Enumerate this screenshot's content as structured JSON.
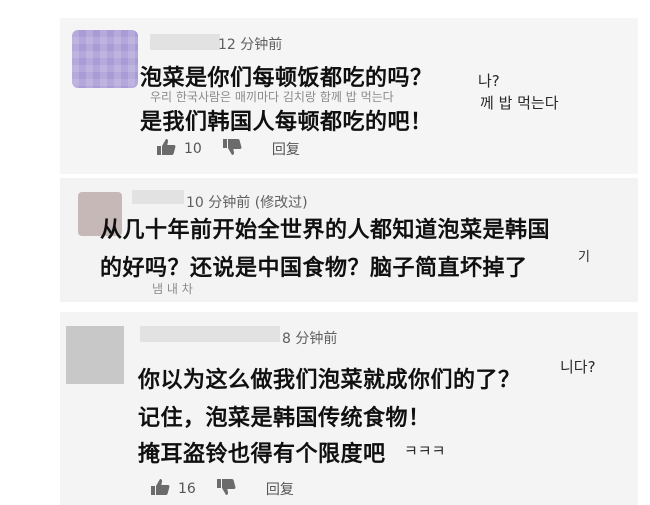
{
  "comments": [
    {
      "time": "12 分钟前",
      "line1": "泡菜是你们每顿饭都吃的吗？",
      "line1_suffix": "나?",
      "ghost_text": "우리 한국사람은 매끼마다 김치랑 함께 밥 먹는다",
      "line2": "是我们韩国人每顿都吃的吧！",
      "line2_suffix": "께 밥 먹는다",
      "likes": "10",
      "reply": "回复"
    },
    {
      "time": "10 分钟前 (修改过)",
      "line1": "从几十年前开始全世界的人都知道泡菜是韩国",
      "line2": "的好吗？还说是中国食物？脑子简直坏掉了",
      "ghost_text": "냄 내 차",
      "line2_suffix": "기"
    },
    {
      "time": "8 分钟前",
      "line1": "你以为这么做我们泡菜就成你们的了？",
      "line1_suffix": "니다?",
      "line2": "记住，泡菜是韩国传统食物！",
      "line3": "掩耳盗铃也得有个限度吧",
      "line3_suffix": "ㅋㅋㅋ",
      "likes": "16",
      "reply": "回复"
    }
  ],
  "icons": [
    "thumb-up-icon",
    "thumb-down-icon"
  ]
}
